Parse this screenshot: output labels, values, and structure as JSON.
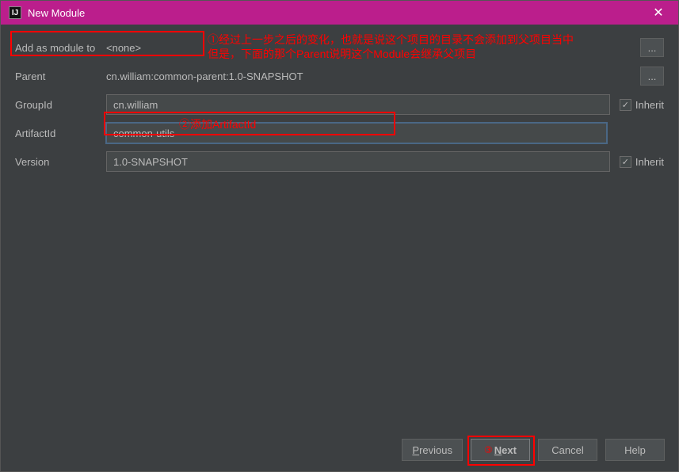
{
  "titlebar": {
    "icon_text": "IJ",
    "title": "New Module",
    "close": "✕"
  },
  "rows": {
    "addModule": {
      "label": "Add as module to",
      "value": "<none>",
      "ellipsis": "..."
    },
    "parent": {
      "label": "Parent",
      "value": "cn.william:common-parent:1.0-SNAPSHOT",
      "ellipsis": "..."
    },
    "groupId": {
      "label": "GroupId",
      "value": "cn.william",
      "inherit_label": "Inherit",
      "checked": "✓"
    },
    "artifactId": {
      "label": "ArtifactId",
      "value": "common-utils"
    },
    "version": {
      "label": "Version",
      "value": "1.0-SNAPSHOT",
      "inherit_label": "Inherit",
      "checked": "✓"
    }
  },
  "annotations": {
    "a1_line1": "①经过上一步之后的变化，也就是说这个项目的目录不会添加到父项目当中",
    "a1_line2": "但是，下面的那个Parent说明这个Module会继承父项目",
    "a2": "②添加ArtifactId",
    "a3": "③"
  },
  "footer": {
    "previous": "Previous",
    "next": "Next",
    "cancel": "Cancel",
    "help": "Help"
  }
}
